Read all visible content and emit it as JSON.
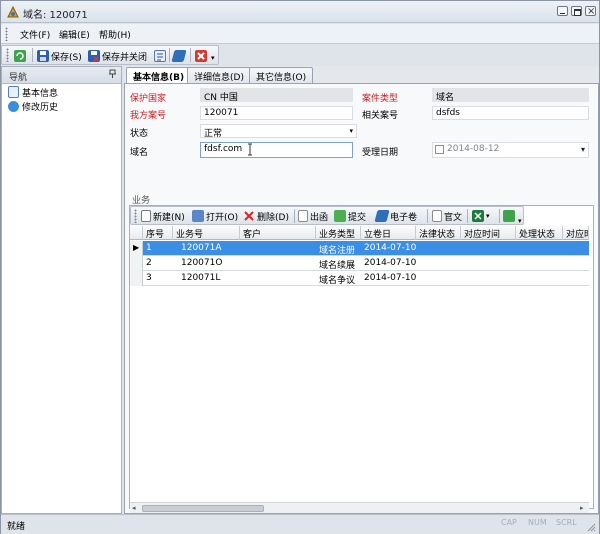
{
  "window": {
    "title": "域名: 120071"
  },
  "menu": {
    "items": [
      "文件(F)",
      "编辑(E)",
      "帮助(H)"
    ]
  },
  "toolbar": {
    "save": "保存(S)",
    "save_close": "保存并关闭"
  },
  "nav": {
    "title": "导航",
    "pin": "ª",
    "items": [
      "基本信息",
      "修改历史"
    ]
  },
  "tabs": [
    "基本信息(B)",
    "详细信息(D)",
    "其它信息(O)"
  ],
  "form": {
    "protect_country_label": "保护国家",
    "protect_country_value": "CN 中国",
    "case_type_label": "案件类型",
    "case_type_value": "域名",
    "our_ref_label": "我方案号",
    "our_ref_value": "120071",
    "related_ref_label": "相关案号",
    "related_ref_value": "dsfds",
    "status_label": "状态",
    "status_value": "正常",
    "domain_label": "域名",
    "domain_value": "fdsf.com",
    "accept_date_label": "受理日期",
    "accept_date_value": "2014-08-12"
  },
  "business": {
    "title": "业务",
    "toolbar": {
      "new": "新建(N)",
      "open": "打开(O)",
      "delete": "删除(D)",
      "issue": "出函",
      "submit": "提交",
      "evolume": "电子卷",
      "official": "官文"
    },
    "columns": [
      "序号",
      "业务号",
      "客户",
      "业务类型",
      "立卷日",
      "法律状态",
      "对应时间",
      "处理状态",
      "对应时"
    ],
    "rows": [
      {
        "no": "1",
        "biz_no": "120071A",
        "client": "",
        "type": "域名注册",
        "date": "2014-07-10",
        "selected": true
      },
      {
        "no": "2",
        "biz_no": "120071O",
        "client": "",
        "type": "域名续展",
        "date": "2014-07-10",
        "selected": false
      },
      {
        "no": "3",
        "biz_no": "120071L",
        "client": "",
        "type": "域名争议",
        "date": "2014-07-10",
        "selected": false
      }
    ]
  },
  "status": {
    "text": "就绪",
    "indicators": [
      "CAP",
      "NUM",
      "SCRL"
    ]
  },
  "colors": {
    "selection": "#3a8ee6",
    "required_label": "#cc1f1f"
  }
}
